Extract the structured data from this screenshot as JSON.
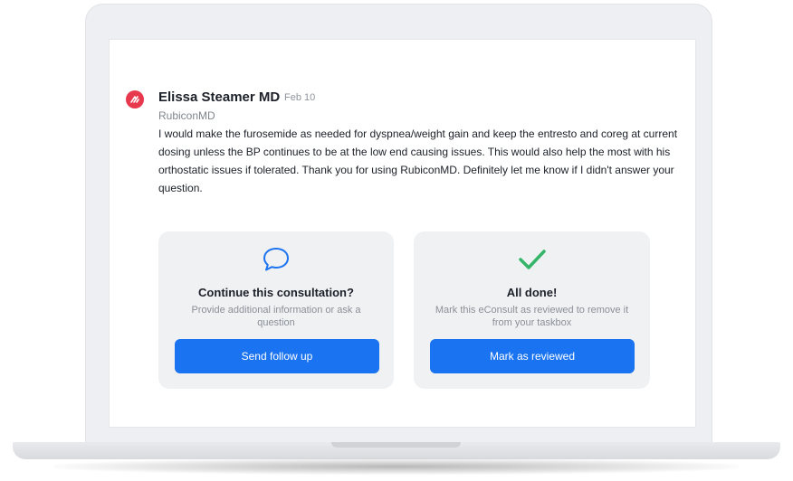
{
  "message": {
    "sender": "Elissa Steamer MD",
    "date": "Feb 10",
    "organization": "RubiconMD",
    "body": "I would make the furosemide as needed for dyspnea/weight gain and keep the entresto and coreg at current dosing unless the BP continues to be at the low end causing issues. This would also help the most with his orthostatic issues if tolerated.  Thank you for using RubiconMD. Definitely let me know if I didn't answer your question."
  },
  "cards": {
    "followup": {
      "icon": "chat-bubble-icon",
      "title": "Continue this consultation?",
      "description": "Provide additional information or ask a question",
      "button": "Send follow up"
    },
    "reviewed": {
      "icon": "checkmark-icon",
      "title": "All done!",
      "description": "Mark this eConsult as reviewed to remove it from your taskbox",
      "button": "Mark as reviewed"
    }
  },
  "colors": {
    "accent": "#1a73f0",
    "avatar": "#e8384d",
    "check": "#35b56a"
  }
}
